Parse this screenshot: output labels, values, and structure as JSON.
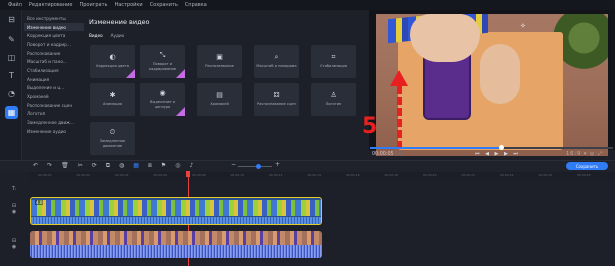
{
  "menu": [
    "Файл",
    "Редактирование",
    "Проиграть",
    "Настройки",
    "Сохранить",
    "Справка"
  ],
  "toolstrip": {
    "icons": [
      "import-icon",
      "magic-wand-icon",
      "filters-icon",
      "titles-icon",
      "transitions-icon",
      "more-tools-icon"
    ]
  },
  "categories": [
    "Все инструменты",
    "Изменение видео",
    "Коррекция цвета",
    "Поворот и кадрир...",
    "Распознавание",
    "Масштаб и пано...",
    "Стабилизация",
    "Анимация",
    "Выделение и ц...",
    "Хромакей",
    "Распознавание сцен",
    "Логотип",
    "Замедленное движ...",
    "Изменение аудио"
  ],
  "panel": {
    "title": "Изменение видео",
    "tabs": [
      "Видео",
      "Аудио"
    ]
  },
  "tiles": [
    {
      "label": "Коррекция цвета",
      "icon": "◐",
      "pro": true
    },
    {
      "label": "Поворот и кадрирование",
      "icon": "⤡",
      "pro": true
    },
    {
      "label": "Распознавание",
      "icon": "▣",
      "pro": false
    },
    {
      "label": "Масштаб и панорама",
      "icon": "⌕",
      "pro": false
    },
    {
      "label": "Стабилизация",
      "icon": "⌗",
      "pro": false
    },
    {
      "label": "Анимация",
      "icon": "✱",
      "pro": false
    },
    {
      "label": "Выделение и цензура",
      "icon": "◉",
      "pro": true
    },
    {
      "label": "Хромакей",
      "icon": "▤",
      "pro": false
    },
    {
      "label": "Распознавание сцен",
      "icon": "⚃",
      "pro": false
    },
    {
      "label": "Логотип",
      "icon": "♙",
      "pro": false
    },
    {
      "label": "Замедленное движение",
      "icon": "⏲",
      "pro": false
    }
  ],
  "preview": {
    "overlay_number": "5",
    "timecode": "00:00:05",
    "timecode_frames": ".132",
    "progress": 0.54,
    "transport": "⏮ ◀ ▶ ▶ ⏭",
    "view_controls": "16:9 ▾  ◎  ⤢"
  },
  "timeline": {
    "tools": [
      "↶",
      "↷",
      "🗑",
      "✂",
      "⟳",
      "⧉",
      "◍",
      "▦",
      "⧈",
      "⚑",
      "◎",
      "♪"
    ],
    "zoom_minus": "−",
    "zoom_plus": "+",
    "save_label": "Сохранить",
    "ruler_ticks": [
      "00:00:00",
      "00:00:02",
      "00:00:04",
      "00:00:06",
      "00:00:08",
      "00:00:10",
      "00:00:12",
      "00:00:14",
      "00:00:16",
      "00:00:18",
      "00:00:20",
      "00:00:22",
      "00:00:24",
      "00:00:26",
      "00:00:28"
    ],
    "video_clip_label": "4.0"
  }
}
